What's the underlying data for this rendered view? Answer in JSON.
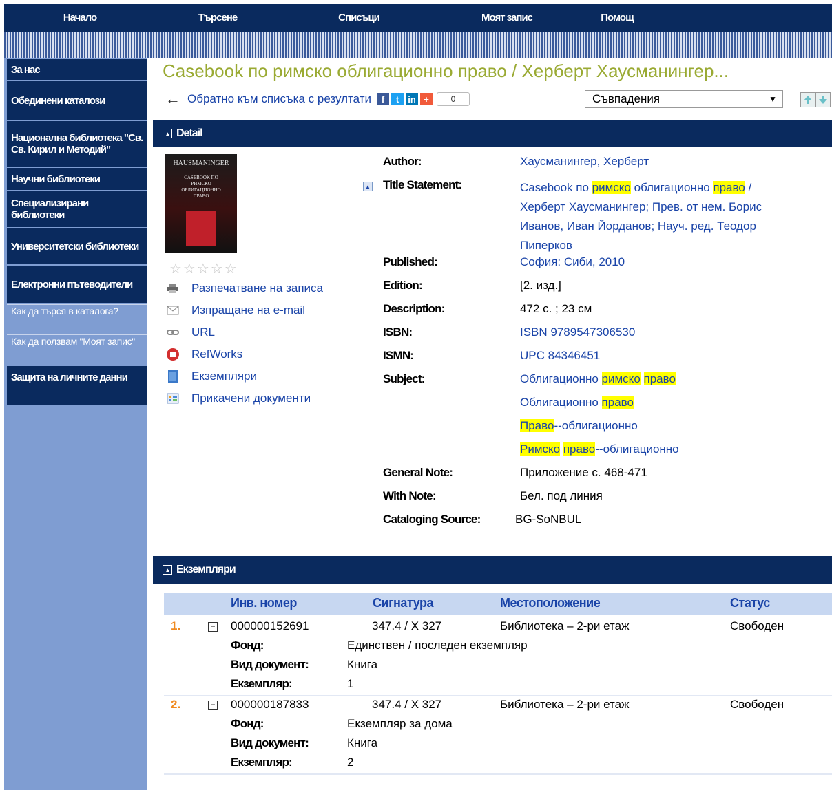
{
  "topnav": [
    "Начало",
    "Търсене",
    "Списъци",
    "Моят запис",
    "Помощ"
  ],
  "sidebar": {
    "items": [
      "За нас",
      "Обединени каталози",
      "Национална библиотека \"Св. Св. Кирил и Методий\"",
      "Научни библиотеки",
      "Специализирани библиотеки",
      "Университетски библиотеки",
      "Електронни пътеводители"
    ],
    "subitems": [
      "Как да търся в каталога?",
      "Как да ползвам \"Моят запис\""
    ],
    "last_item": "Защита на личните данни"
  },
  "record_title": "Casebook по римско облигационно право / Херберт Хаусманингер...",
  "back_link": "Обратно към списъка с резултати",
  "share_count": "0",
  "sort_select": "Съвпадения",
  "colors": {
    "nav": "#0a2a5e",
    "sidebar": "#7f9dd2",
    "title": "#9aaa33",
    "link": "#1a44a8",
    "highlight": "#ffff00",
    "number": "#f08a20"
  },
  "detail_section": "Detail",
  "cover": {
    "top_text": "HAUSMANINGER",
    "caption": "CASEBOOK ПО РИМСКО ОБЛИГАЦИОННО ПРАВО"
  },
  "rating_stars": "☆☆☆☆☆",
  "actions": [
    "Разпечатване на записа",
    "Изпращане на e-mail",
    "URL",
    "RefWorks",
    "Екземпляри",
    "Прикачени документи"
  ],
  "fields": {
    "author_label": "Author:",
    "author": "Хаусманингер, Херберт",
    "title_label": "Title Statement:",
    "title_line1_a": "Casebook по ",
    "title_line1_b": "римско",
    "title_line1_c": " облигационно ",
    "title_line1_d": "право",
    "title_line1_e": " /",
    "title_line2": "Херберт Хаусманингер; Прев. от нем. Борис",
    "title_line3": "Иванов, Иван Йорданов; Науч. ред. Теодор",
    "title_line4": "Пиперков",
    "published_label": "Published:",
    "published": "София: Сиби, 2010",
    "edition_label": "Edition:",
    "edition": "[2. изд.]",
    "description_label": "Description:",
    "description": "472 с. ; 23 см",
    "isbn_label": "ISBN:",
    "isbn": "ISBN 9789547306530",
    "ismn_label": "ISMN:",
    "ismn": "UPC 84346451",
    "subject_label": "Subject:",
    "subj1_a": "Облигационно ",
    "subj1_b": "римско",
    "subj1_c": "право",
    "subj2_a": "Облигационно ",
    "subj2_b": "право",
    "subj3_a": "Право",
    "subj3_b": "--облигационно",
    "subj4_a": "Римско",
    "subj4_b": "право",
    "subj4_c": "--облигационно",
    "general_note_label": "General Note:",
    "general_note": "Приложение с. 468-471",
    "with_note_label": "With Note:",
    "with_note": "Бел. под линия",
    "cataloging_label": "Cataloging Source:",
    "cataloging": "BG-SoNBUL"
  },
  "holdings_section": "Екземпляри",
  "holdings": {
    "headers": [
      "Инв. номер",
      "Сигнатура",
      "Местоположение",
      "Статус"
    ],
    "sub_labels": {
      "fund": "Фонд:",
      "doc_type": "Вид документ:",
      "copy": "Екземпляр:"
    },
    "rows": [
      {
        "num": "1.",
        "toggle": "−",
        "inv": "000000152691",
        "signature": "347.4 / Х 327",
        "location": "Библиотека – 2-ри етаж",
        "status": "Свободен",
        "fund": "Единствен / последен екземпляр",
        "doc_type": "Книга",
        "copy": "1"
      },
      {
        "num": "2.",
        "toggle": "−",
        "inv": "000000187833",
        "signature": "347.4 / Х 327",
        "location": "Библиотека – 2-ри етаж",
        "status": "Свободен",
        "fund": "Екземпляр за дома",
        "doc_type": "Книга",
        "copy": "2"
      }
    ]
  }
}
